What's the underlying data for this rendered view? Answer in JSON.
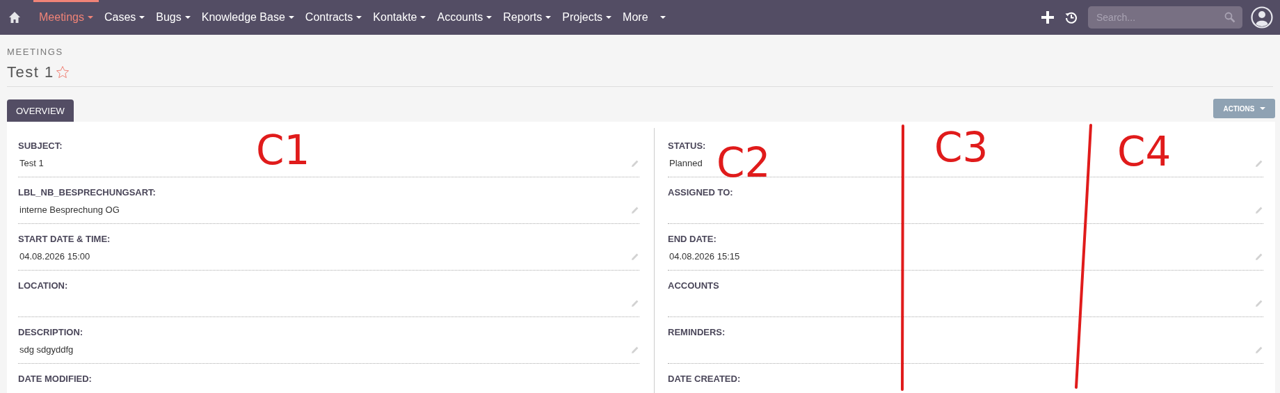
{
  "nav": {
    "items": [
      {
        "label": "Meetings",
        "selected": true
      },
      {
        "label": "Cases",
        "selected": false
      },
      {
        "label": "Bugs",
        "selected": false
      },
      {
        "label": "Knowledge Base",
        "selected": false
      },
      {
        "label": "Contracts",
        "selected": false
      },
      {
        "label": "Kontakte",
        "selected": false
      },
      {
        "label": "Accounts",
        "selected": false
      },
      {
        "label": "Reports",
        "selected": false
      },
      {
        "label": "Projects",
        "selected": false
      },
      {
        "label": "More",
        "selected": false
      }
    ],
    "search": {
      "placeholder": "Search..."
    }
  },
  "header": {
    "module": "MEETINGS",
    "title": "Test 1",
    "favorite": false
  },
  "tabs": [
    {
      "label": "OVERVIEW",
      "selected": true
    }
  ],
  "actions_button": "ACTIONS",
  "detail": {
    "left": [
      {
        "label": "SUBJECT:",
        "value": "Test 1"
      },
      {
        "label": "LBL_NB_BESPRECHUNGSART:",
        "value": "interne Besprechung OG"
      },
      {
        "label": "START DATE & TIME:",
        "value": "04.08.2026 15:00"
      },
      {
        "label": "LOCATION:"
      },
      {
        "label": "DESCRIPTION:",
        "value": "sdg sdgyddfg"
      },
      {
        "label": "DATE MODIFIED:"
      }
    ],
    "right": [
      {
        "label": "STATUS:",
        "value": "Planned"
      },
      {
        "label": "ASSIGNED TO:"
      },
      {
        "label": "END DATE:",
        "value": "04.08.2026 15:15"
      },
      {
        "label": "ACCOUNTS"
      },
      {
        "label": "REMINDERS:"
      },
      {
        "label": "DATE CREATED:"
      }
    ]
  },
  "annotations": [
    {
      "kind": "label",
      "text": "C1"
    },
    {
      "kind": "label",
      "text": "C2"
    },
    {
      "kind": "line"
    },
    {
      "kind": "label",
      "text": "C3"
    },
    {
      "kind": "line"
    },
    {
      "kind": "label",
      "text": "C4"
    }
  ]
}
